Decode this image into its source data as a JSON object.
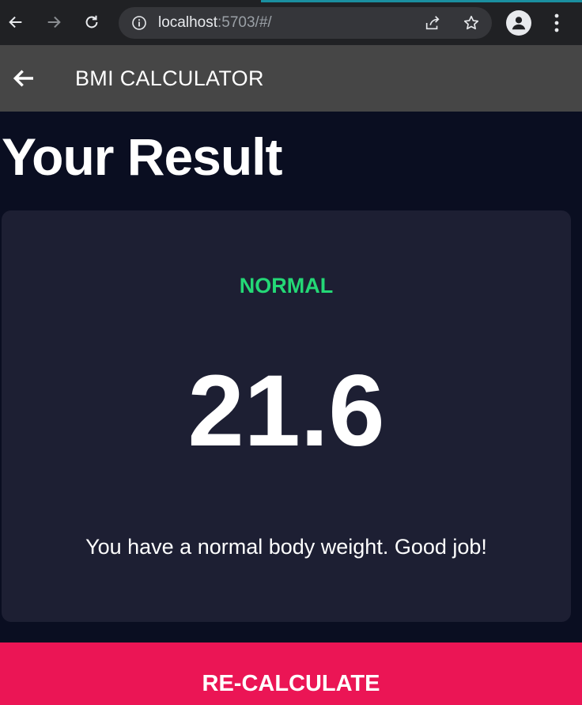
{
  "browser": {
    "url_host": "localhost",
    "url_rest": ":5703/#/"
  },
  "appbar": {
    "title": "BMI CALCULATOR"
  },
  "page": {
    "title": "Your Result"
  },
  "result": {
    "status": "NORMAL",
    "bmi": "21.6",
    "message": "You have a normal body weight. Good job!"
  },
  "actions": {
    "recalculate_label": "RE-CALCULATE"
  },
  "colors": {
    "background": "#0a0e21",
    "card": "#1d1f33",
    "status_green": "#24d876",
    "button_pink": "#eb1555",
    "appbar": "#464646"
  },
  "icons": {
    "back": "arrow-left-icon",
    "forward": "arrow-right-icon",
    "reload": "reload-icon",
    "info": "info-icon",
    "share": "share-icon",
    "bookmark": "star-icon",
    "profile": "profile-icon",
    "menu": "more-vert-icon"
  }
}
